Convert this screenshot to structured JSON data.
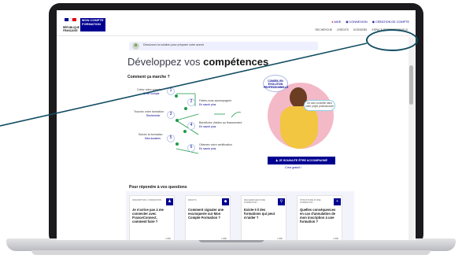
{
  "header": {
    "gov_name": "RÉPUBLIQUE FRANÇAISE",
    "brand": "MON COMPTE FORMATION",
    "top_links": {
      "help": "AIDE",
      "login": "CONNEXION",
      "create_account": "CRÉATION DE COMPTE"
    },
    "sub_links": [
      "RECHERCHE",
      "CRÉDITS",
      "DOSSIERS",
      "ESPACE PROFESSIONNELS"
    ]
  },
  "banner": {
    "text": "Découvrez la solution pour préparer votre avenir"
  },
  "hero": {
    "title_light": "Développez vos",
    "title_bold": "compétences",
    "how_title": "Comment ça marche ?",
    "steps": [
      {
        "label": "Créez votre compte",
        "link": "Créer compte",
        "number": "1"
      },
      {
        "label": "Faites-vous accompagner",
        "link": "En savoir plus",
        "number": "2"
      },
      {
        "label": "Trouvez votre formation",
        "link": "Rechercher",
        "number": "3"
      },
      {
        "label": "Bénéficiez d'aides au financement",
        "link": "En savoir plus",
        "number": "4"
      },
      {
        "label": "Suivez la formation",
        "link": "Mes dossiers",
        "number": "5"
      },
      {
        "label": "Obtenez votre certification",
        "link": "En savoir plus",
        "number": "6"
      }
    ],
    "badge": "CONSEIL EN ÉVOLUTION PROFESSIONNELLE",
    "bubble": "Un avis conseillé dans votre projet professionnel",
    "cta": "JE SOUHAITE ÊTRE ACCOMPAGNÉ",
    "cta_sub": "C'est gratuit !"
  },
  "faq": {
    "title": "Pour répondre à vos questions",
    "cards": [
      {
        "category": "Inscription / formation",
        "question": "Je n'arrive pas à me connecter avec FranceConnect, comment faire ?",
        "icon": "person-icon",
        "more": "LIRE"
      },
      {
        "category": "Droits",
        "question": "Comment signaler une escroquerie sur Mon Compte Formation ?",
        "icon": "shield-icon",
        "more": "LIRE"
      },
      {
        "category": "Recherche d'une formation",
        "question": "Existe-t-il des formations qui peut m'aider ?",
        "icon": "search-icon",
        "more": "LIRE"
      },
      {
        "category": "Structure d'une formation",
        "question": "Quelles conséquences en cas d'annulation de mon inscription à une formation ?",
        "icon": "plus-icon",
        "more": "LIRE"
      }
    ]
  },
  "colors": {
    "primary": "#000091",
    "accent_red": "#e1000f",
    "annotation": "#114d62"
  }
}
